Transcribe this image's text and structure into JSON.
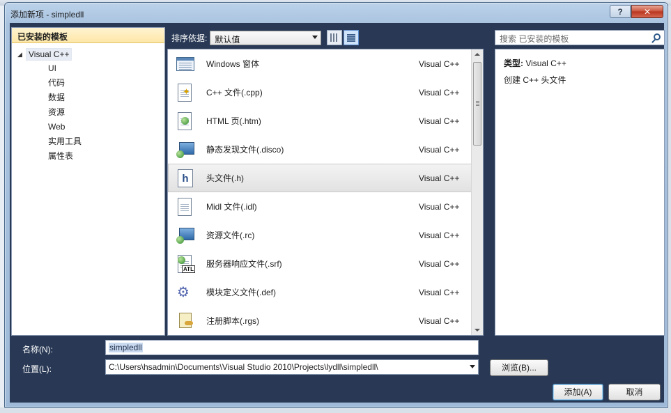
{
  "window": {
    "title": "添加新项 - simpledll",
    "help_btn": "?",
    "close_btn": "✕"
  },
  "left": {
    "header": "已安装的模板",
    "root": "Visual C++",
    "children": [
      "UI",
      "代码",
      "数据",
      "资源",
      "Web",
      "实用工具",
      "属性表"
    ]
  },
  "toolbar": {
    "sort_label": "排序依据:",
    "sort_value": "默认值"
  },
  "search": {
    "placeholder": "搜索 已安装的模板"
  },
  "templates": [
    {
      "name": "Windows 窗体",
      "lang": "Visual C++",
      "icon": "windows-form-icon"
    },
    {
      "name": "C++ 文件(.cpp)",
      "lang": "Visual C++",
      "icon": "cpp-file-icon"
    },
    {
      "name": "HTML 页(.htm)",
      "lang": "Visual C++",
      "icon": "html-page-icon"
    },
    {
      "name": "静态发现文件(.disco)",
      "lang": "Visual C++",
      "icon": "disco-file-icon"
    },
    {
      "name": "头文件(.h)",
      "lang": "Visual C++",
      "icon": "header-file-icon",
      "selected": true
    },
    {
      "name": "Midl 文件(.idl)",
      "lang": "Visual C++",
      "icon": "midl-file-icon"
    },
    {
      "name": "资源文件(.rc)",
      "lang": "Visual C++",
      "icon": "resource-file-icon"
    },
    {
      "name": "服务器响应文件(.srf)",
      "lang": "Visual C++",
      "icon": "srf-file-icon"
    },
    {
      "name": "模块定义文件(.def)",
      "lang": "Visual C++",
      "icon": "def-file-icon"
    },
    {
      "name": "注册脚本(.rgs)",
      "lang": "Visual C++",
      "icon": "rgs-file-icon"
    }
  ],
  "details": {
    "type_label": "类型:",
    "type_value": "Visual C++",
    "description": "创建 C++ 头文件"
  },
  "bottom": {
    "name_label": "名称(N):",
    "name_value": "simpledll",
    "location_label": "位置(L):",
    "location_value": "C:\\Users\\hsadmin\\Documents\\Visual Studio 2010\\Projects\\lydll\\simpledll\\",
    "browse_label": "浏览(B)...",
    "add_label": "添加(A)",
    "cancel_label": "取消"
  }
}
